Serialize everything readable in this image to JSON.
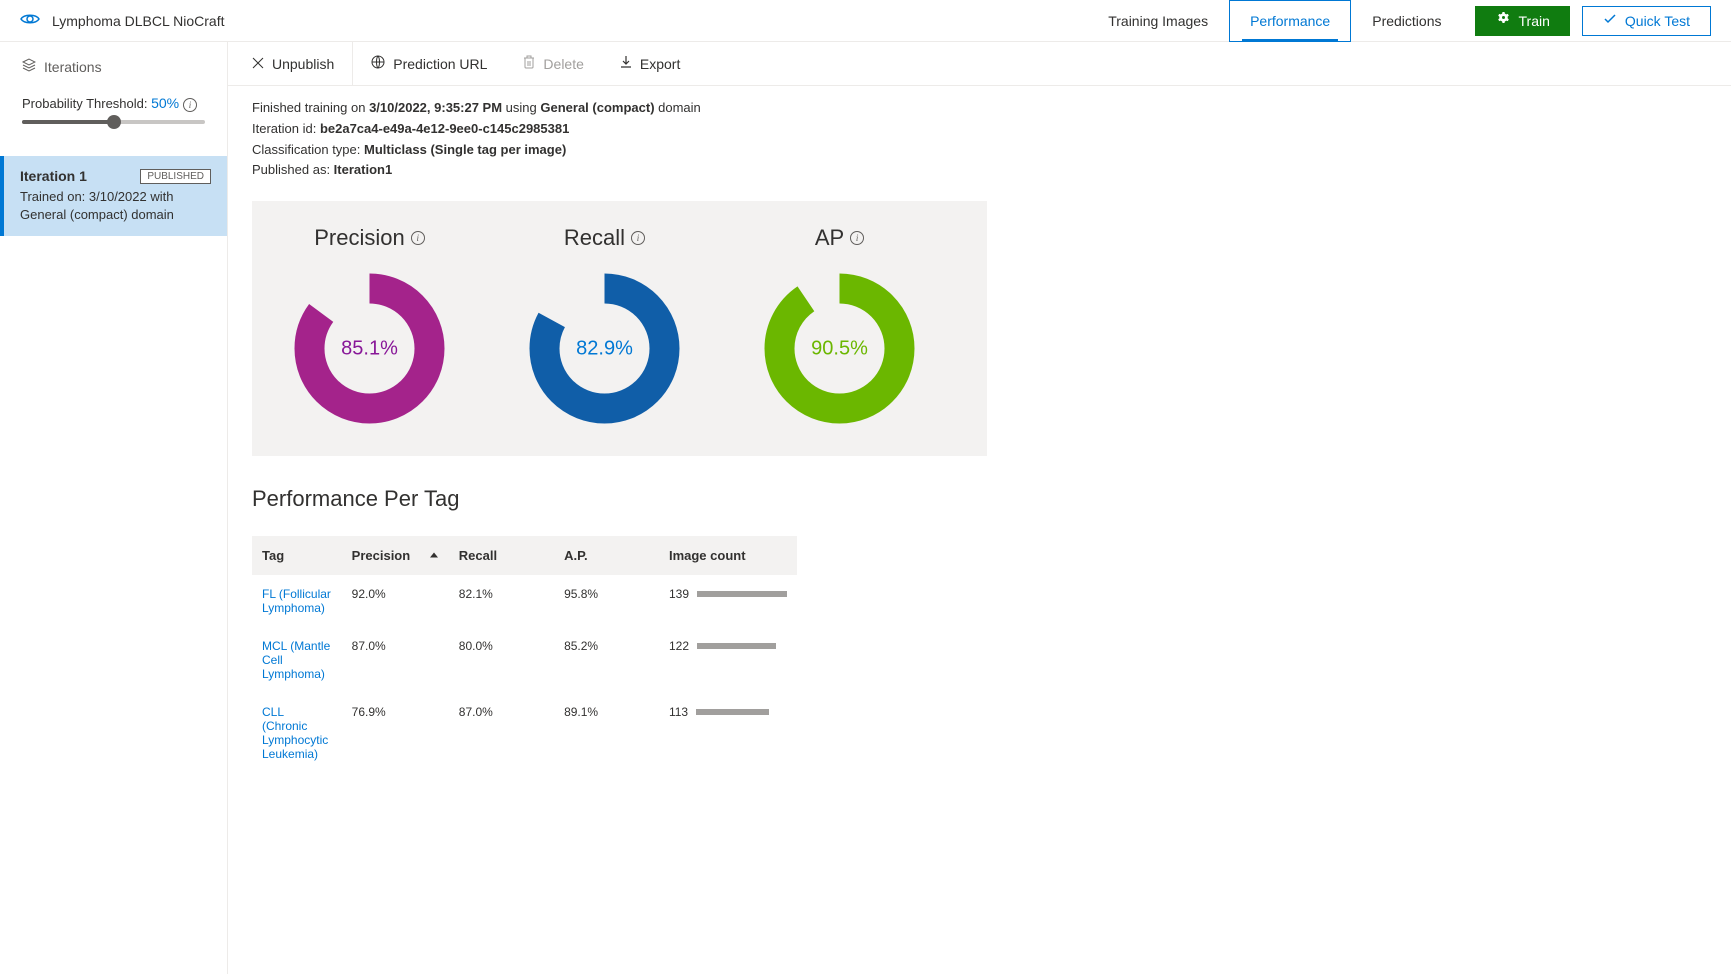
{
  "header": {
    "project_title": "Lymphoma DLBCL NioCraft",
    "tabs": {
      "training_images": "Training Images",
      "performance": "Performance",
      "predictions": "Predictions"
    },
    "train_btn": "Train",
    "quicktest_btn": "Quick Test"
  },
  "sidebar": {
    "iterations_label": "Iterations",
    "threshold_label": "Probability Threshold: ",
    "threshold_value": "50%",
    "iteration": {
      "name": "Iteration 1",
      "badge": "PUBLISHED",
      "desc": "Trained on: 3/10/2022 with General (compact) domain"
    }
  },
  "actions": {
    "unpublish": "Unpublish",
    "prediction_url": "Prediction URL",
    "delete": "Delete",
    "export": "Export"
  },
  "info": {
    "line1_a": "Finished training on ",
    "line1_b": "3/10/2022, 9:35:27 PM",
    "line1_c": " using ",
    "line1_d": "General (compact)",
    "line1_e": " domain",
    "line2_a": "Iteration id: ",
    "line2_b": "be2a7ca4-e49a-4e12-9ee0-c145c2985381",
    "line3_a": "Classification type: ",
    "line3_b": "Multiclass (Single tag per image)",
    "line4_a": "Published as: ",
    "line4_b": "Iteration1"
  },
  "metrics": {
    "precision": {
      "label": "Precision",
      "value": "85.1%",
      "pct": 85.1,
      "color": "#a4238b"
    },
    "recall": {
      "label": "Recall",
      "value": "82.9%",
      "pct": 82.9,
      "color": "#105ea8"
    },
    "ap": {
      "label": "AP",
      "value": "90.5%",
      "pct": 90.5,
      "color": "#6bb700"
    }
  },
  "chart_data": [
    {
      "type": "pie",
      "title": "Precision",
      "values": [
        85.1,
        14.9
      ],
      "categories": [
        "Precision",
        "Remainder"
      ]
    },
    {
      "type": "pie",
      "title": "Recall",
      "values": [
        82.9,
        17.1
      ],
      "categories": [
        "Recall",
        "Remainder"
      ]
    },
    {
      "type": "pie",
      "title": "AP",
      "values": [
        90.5,
        9.5
      ],
      "categories": [
        "AP",
        "Remainder"
      ]
    }
  ],
  "perf_table": {
    "title": "Performance Per Tag",
    "headers": {
      "tag": "Tag",
      "precision": "Precision",
      "recall": "Recall",
      "ap": "A.P.",
      "count": "Image count"
    },
    "rows": [
      {
        "tag": "FL (Follicular Lymphoma)",
        "precision": "92.0%",
        "recall": "82.1%",
        "ap": "95.8%",
        "count": "139",
        "bar": 100
      },
      {
        "tag": "MCL (Mantle Cell Lymphoma)",
        "precision": "87.0%",
        "recall": "80.0%",
        "ap": "85.2%",
        "count": "122",
        "bar": 88
      },
      {
        "tag": "CLL (Chronic Lymphocytic Leukemia)",
        "precision": "76.9%",
        "recall": "87.0%",
        "ap": "89.1%",
        "count": "113",
        "bar": 81
      }
    ]
  }
}
